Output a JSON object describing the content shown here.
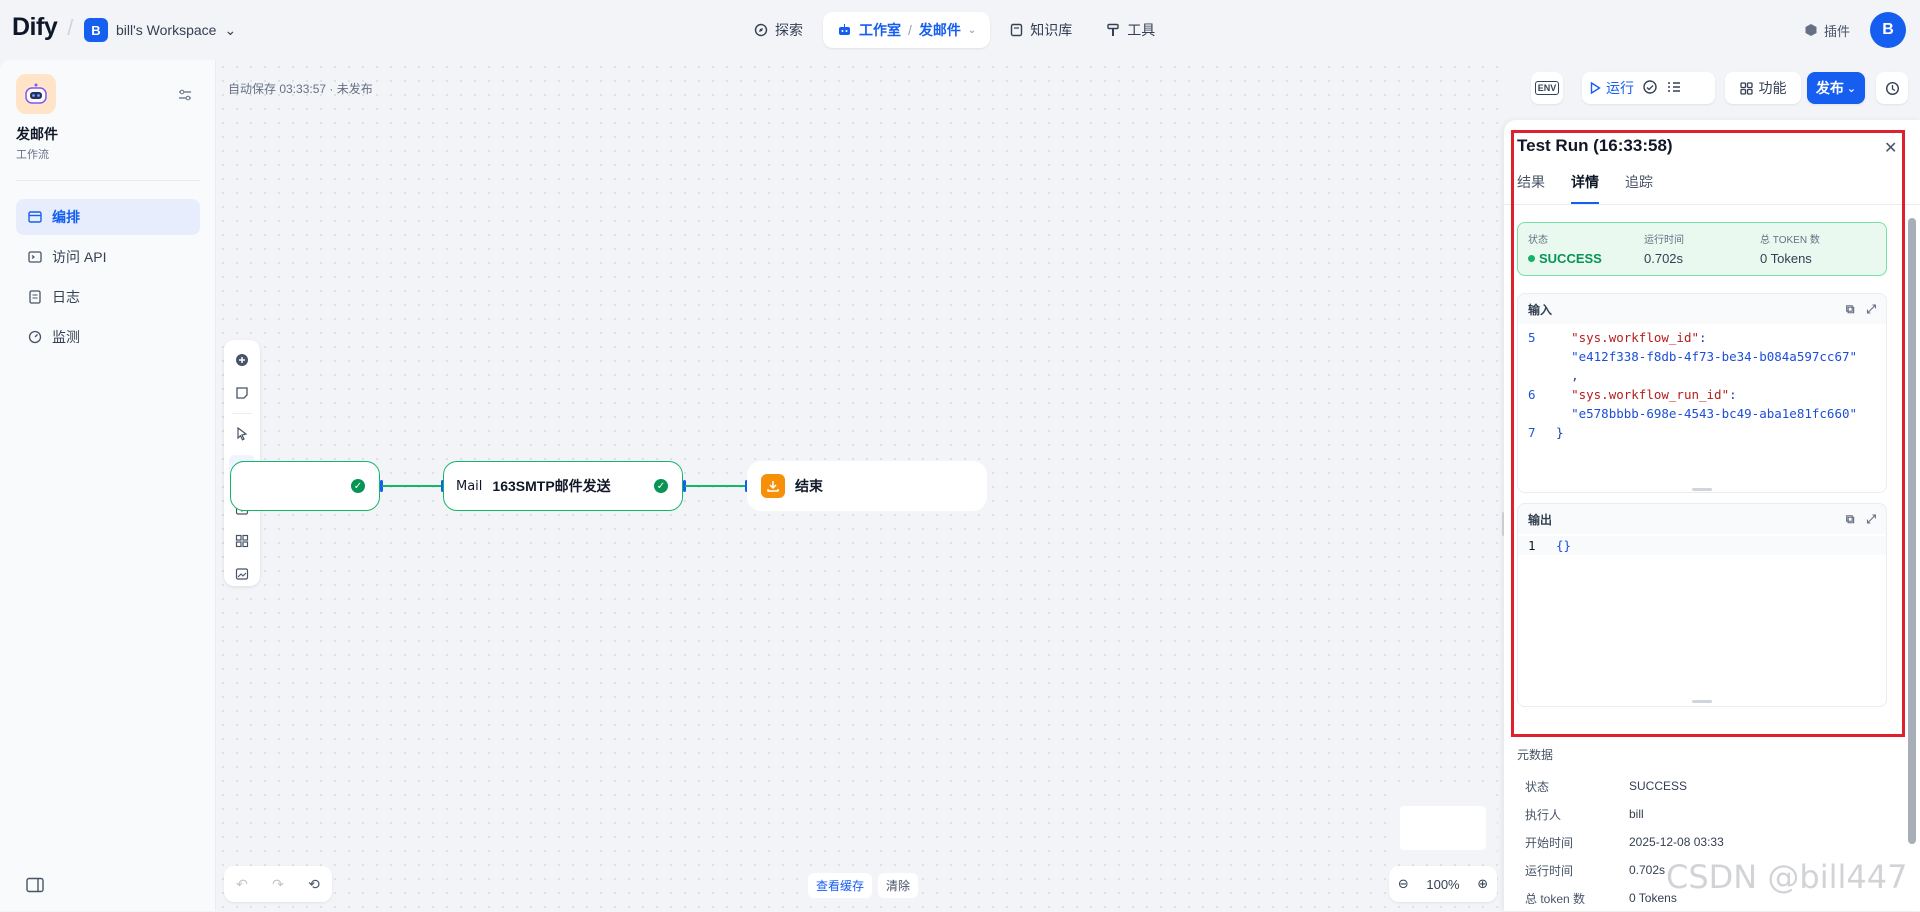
{
  "app": {
    "logo": "Dify",
    "workspace_initial": "B",
    "workspace_name": "bill's Workspace"
  },
  "topnav": [
    {
      "label": "探索"
    },
    {
      "label": "工作室",
      "sub": "发邮件"
    },
    {
      "label": "知识库"
    },
    {
      "label": "工具"
    }
  ],
  "topright": {
    "plugins_label": "插件",
    "user_initial": "B"
  },
  "sidebar": {
    "app_name": "发邮件",
    "app_type": "工作流",
    "items": [
      {
        "label": "编排",
        "icon": "layout-icon"
      },
      {
        "label": "访问 API",
        "icon": "terminal-icon"
      },
      {
        "label": "日志",
        "icon": "file-text-icon"
      },
      {
        "label": "监测",
        "icon": "gauge-icon"
      }
    ]
  },
  "canvas": {
    "autosave": "自动保存 03:33:57 · 未发布",
    "nodes": [
      {
        "label": "",
        "status": "success"
      },
      {
        "type_label": "Mail",
        "label": "163SMTP邮件发送",
        "status": "success"
      },
      {
        "label": "结束"
      }
    ],
    "bottom": {
      "cache_label": "查看缓存",
      "clear_label": "清除"
    },
    "zoom": "100%"
  },
  "toolbar": {
    "env": "ENV",
    "run": "运行",
    "features": "功能",
    "publish": "发布"
  },
  "panel": {
    "title": "Test Run (16:33:58)",
    "tabs": [
      "结果",
      "详情",
      "追踪"
    ],
    "active_tab": 1,
    "status": {
      "status_label": "状态",
      "status_value": "SUCCESS",
      "time_label": "运行时间",
      "time_value": "0.702s",
      "tokens_label": "总 TOKEN 数",
      "tokens_value": "0 Tokens"
    },
    "input": {
      "title": "输入",
      "lines": [
        {
          "n": "5",
          "key": "\"sys.workflow_id\"",
          "val": "\"e412f338-f8db-4f73-be34-b084a597cc67\"",
          "comma": ","
        },
        {
          "n": "6",
          "key": "\"sys.workflow_run_id\"",
          "val": "\"e578bbbb-698e-4543-bc49-aba1e81fc660\""
        },
        {
          "n": "7",
          "text": "}"
        }
      ]
    },
    "output": {
      "title": "输出",
      "lines": [
        {
          "n": "1",
          "text": "{}"
        }
      ]
    },
    "meta": {
      "title": "元数据",
      "rows": [
        {
          "k": "状态",
          "v": "SUCCESS"
        },
        {
          "k": "执行人",
          "v": "bill"
        },
        {
          "k": "开始时间",
          "v": "2025-12-08 03:33"
        },
        {
          "k": "运行时间",
          "v": "0.702s"
        },
        {
          "k": "总 token 数",
          "v": "0 Tokens"
        }
      ]
    }
  },
  "watermark": "CSDN @bill447",
  "colors": {
    "accent": "#155eef",
    "success": "#12b76a",
    "highlight": "#e0202c",
    "end_node": "#f79009"
  }
}
